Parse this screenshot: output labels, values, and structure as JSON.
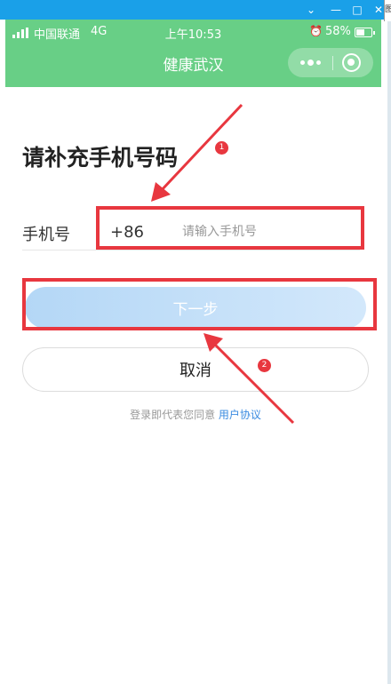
{
  "window": {
    "chevron_icon": "chevron-down-icon",
    "minimize_icon": "minimize-icon",
    "maximize_icon": "maximize-icon",
    "close_icon": "close-icon"
  },
  "status_bar": {
    "carrier": "中国联通",
    "network": "4G",
    "time": "上午10:53",
    "battery": "58%",
    "battery_level": 0.58
  },
  "header": {
    "title": "健康武汉",
    "more_icon": "more-dots-icon",
    "close_icon": "target-close-icon"
  },
  "form": {
    "heading": "请补充手机号码",
    "phone_label": "手机号",
    "country_code": "+86",
    "phone_value": "",
    "phone_placeholder": "请输入手机号",
    "next_label": "下一步",
    "cancel_label": "取消"
  },
  "agreement": {
    "text": "登录即代表您同意",
    "link": "用户协议"
  },
  "annotations": {
    "badge_1": "1",
    "badge_2": "2",
    "color": "#e8373f"
  },
  "colors": {
    "header_green": "#68cf86",
    "window_blue": "#1aa0e8",
    "link_blue": "#3a8be0"
  },
  "edge_text": "图"
}
